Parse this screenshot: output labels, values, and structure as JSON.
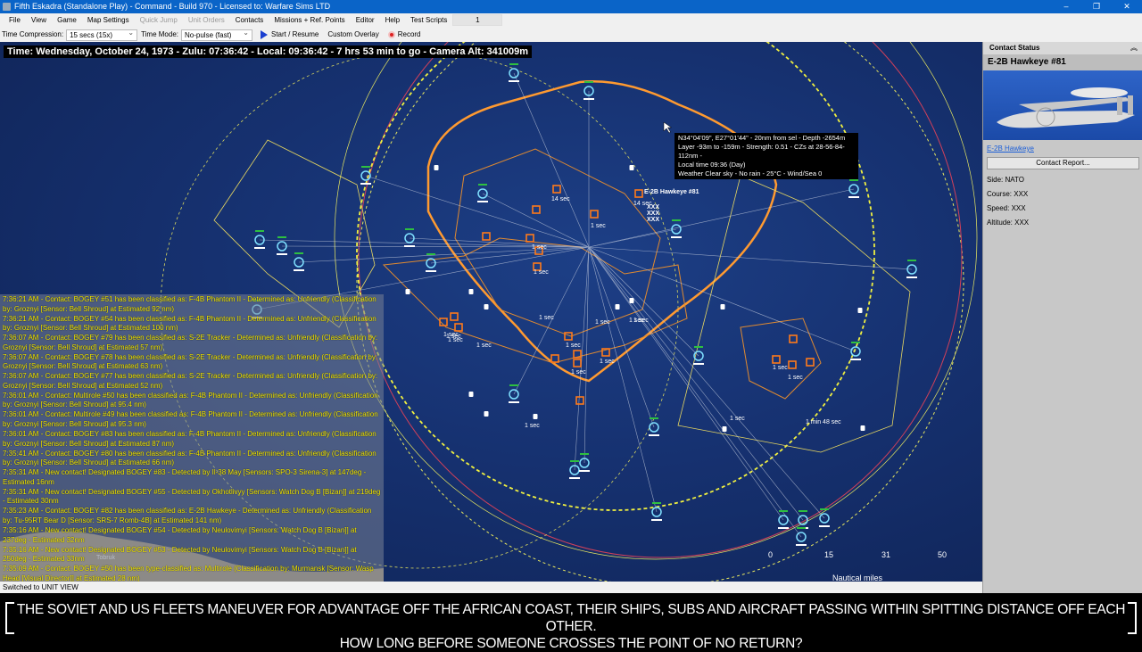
{
  "window": {
    "title": "Fifth Eskadra (Standalone Play) - Command - Build 970 - Licensed to: Warfare Sims LTD",
    "buttons": [
      "–",
      "❐",
      "✕"
    ]
  },
  "menu": {
    "items": [
      {
        "label": "File",
        "enabled": true
      },
      {
        "label": "View",
        "enabled": true
      },
      {
        "label": "Game",
        "enabled": true
      },
      {
        "label": "Map Settings",
        "enabled": true
      },
      {
        "label": "Quick Jump",
        "enabled": false
      },
      {
        "label": "Unit Orders",
        "enabled": false
      },
      {
        "label": "Contacts",
        "enabled": true
      },
      {
        "label": "Missions + Ref. Points",
        "enabled": true
      },
      {
        "label": "Editor",
        "enabled": true
      },
      {
        "label": "Help",
        "enabled": true
      },
      {
        "label": "Test Scripts",
        "enabled": true
      }
    ],
    "number_box": "1"
  },
  "toolbar": {
    "time_compression_label": "Time Compression:",
    "time_compression_value": "15 secs (15x)",
    "time_mode_label": "Time Mode:",
    "time_mode_value": "No-pulse (fast)",
    "start_label": "Start / Resume",
    "overlay_label": "Custom Overlay",
    "record_label": "Record"
  },
  "map": {
    "time_readout": "Time: Wednesday, October 24, 1973 - Zulu: 07:36:42 - Local: 09:36:42 - 7 hrs 53 min to go -  Camera Alt: 341009m",
    "tooltip": [
      "N34°04'09\", E27°01'44\" - 20nm from sel - Depth -2654m",
      "Layer -93m to -159m - Strength: 0.51 - CZs at 28-56-84-112nm -",
      "Local time 09:36 (Day)",
      "Weather Clear sky - No rain - 25°C - Wind/Sea 0"
    ],
    "selected_unit_label": "E-2B Hawkeye #81",
    "unit_labels": [
      "14 sec",
      "14 sec",
      "XXX",
      "XXX",
      "XXX",
      "1 sec",
      "1 sec",
      "1 sec",
      "1 sec",
      "1 sec",
      "1 sec",
      "1 sec",
      "1 sec",
      "1 sec",
      "1 sec",
      "1 sec",
      "1 sec",
      "1 sec",
      "1 sec",
      "1 sec",
      "1 sec",
      "1 min 48 sec",
      "1 sec",
      "1 sec"
    ],
    "place_label": "Tobruk",
    "scale": {
      "ticks": [
        "0",
        "15",
        "31",
        "50"
      ],
      "unit": "Nautical miles"
    },
    "colors": {
      "hostile": "#ff7a1a",
      "friendly": "#7fe0ff",
      "range_ring_yellow": "#e8e860",
      "range_ring_red": "#d0405a",
      "sea": "#163170"
    }
  },
  "log": {
    "messages": [
      "7:36:21 AM - Contact: BOGEY #51 has been classified as: F-4B Phantom II - Determined as: Unfriendly (Classification by: Groznyi [Sensor: Bell Shroud] at Estimated 92 nm)",
      "7:36:21 AM - Contact: BOGEY #54 has been classified as: F-4B Phantom II - Determined as: Unfriendly (Classification by: Groznyi [Sensor: Bell Shroud] at Estimated 100 nm)",
      "7:36:07 AM - Contact: BOGEY #79 has been classified as: S-2E Tracker - Determined as: Unfriendly (Classification by: Groznyi [Sensor: Bell Shroud] at Estimated 57 nm)",
      "7:36:07 AM - Contact: BOGEY #78 has been classified as: S-2E Tracker - Determined as: Unfriendly (Classification by: Groznyi [Sensor: Bell Shroud] at Estimated 63 nm)",
      "7:36:07 AM - Contact: BOGEY #77 has been classified as: S-2E Tracker - Determined as: Unfriendly (Classification by: Groznyi [Sensor: Bell Shroud] at Estimated 52 nm)",
      "7:36:01 AM - Contact: Multirole #50 has been classified as: F-4B Phantom II - Determined as: Unfriendly (Classification by: Groznyi [Sensor: Bell Shroud] at 95.4 nm)",
      "7:36:01 AM - Contact: Multirole #49 has been classified as: F-4B Phantom II - Determined as: Unfriendly (Classification by: Groznyi [Sensor: Bell Shroud] at 95.3 nm)",
      "7:36:01 AM - Contact: BOGEY #83 has been classified as: F-4B Phantom II - Determined as: Unfriendly (Classification by: Groznyi [Sensor: Bell Shroud] at Estimated 87 nm)",
      "7:35:41 AM - Contact: BOGEY #80 has been classified as: F-4B Phantom II - Determined as: Unfriendly (Classification by: Groznyi [Sensor: Bell Shroud] at Estimated 66 nm)",
      "7:35:31 AM - New contact! Designated BOGEY #83 - Detected by Il-38 May  [Sensors: SPO-3 Sirena-3] at 147deg - Estimated 16nm",
      "7:35:31 AM - New contact! Designated BOGEY #55 - Detected by Okhotlivyy  [Sensors: Watch Dog B [Bizan]] at 219deg - Estimated 30nm",
      "7:35:23 AM - Contact: BOGEY #82 has been classified as: E-2B Hawkeye - Determined as: Unfriendly (Classification by: Tu-95RT Bear D [Sensor: SRS-7 Romb-4B] at Estimated 141 nm)",
      "7:35:16 AM - New contact! Designated BOGEY #54 - Detected by Neulovimyi  [Sensors: Watch Dog B [Bizan]] at 237deg - Estimated 32nm",
      "7:35:16 AM - New contact! Designated BOGEY #53 - Detected by Neulovimyi  [Sensors: Watch Dog B [Bizan]] at 250deg - Estimated 33nm",
      "7:35:09 AM - Contact: BOGEY #50 has been type-classified as: Multirole (Classification by: Murmansk  [Sensor: Wasp Head [Visual Director]] at Estimated 28 nm)"
    ]
  },
  "status": {
    "text": "Switched to UNIT VIEW"
  },
  "panel": {
    "header": "Contact Status",
    "collapse_icon": "︽",
    "contact_name": "E-2B Hawkeye #81",
    "type_link": "E-2B Hawkeye",
    "report_button": "Contact Report...",
    "fields": [
      "Side: NATO",
      "Course: XXX",
      "Speed: XXX",
      "Altitude: XXX"
    ]
  },
  "caption": {
    "lines": [
      "THE SOVIET AND US FLEETS MANEUVER FOR ADVANTAGE OFF THE AFRICAN COAST, THEIR SHIPS, SUBS AND AIRCRAFT PASSING WITHIN SPITTING DISTANCE OFF EACH OTHER.",
      "HOW LONG BEFORE SOMEONE CROSSES THE POINT OF NO RETURN?"
    ]
  }
}
